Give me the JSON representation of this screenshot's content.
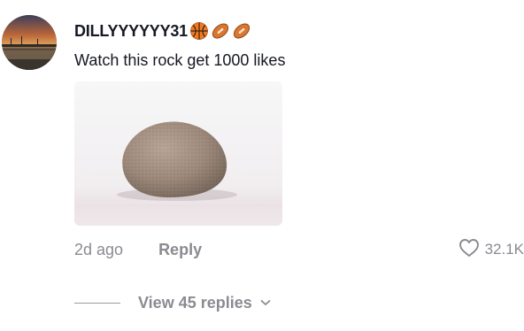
{
  "comment": {
    "username": "DILLYYYYYY31",
    "username_emojis": [
      "basketball-emoji",
      "football-emoji",
      "football-emoji"
    ],
    "text": "Watch this rock get 1000 likes",
    "attachment_icon": "rock-image",
    "time": "2d ago",
    "reply_label": "Reply",
    "like_icon": "heart-outline-icon",
    "like_count": "32.1K",
    "view_replies_label": "View 45 replies",
    "view_replies_icon": "chevron-down-icon"
  },
  "colors": {
    "text_primary": "#161823",
    "text_secondary": "#8a8b91",
    "background": "#ffffff"
  }
}
